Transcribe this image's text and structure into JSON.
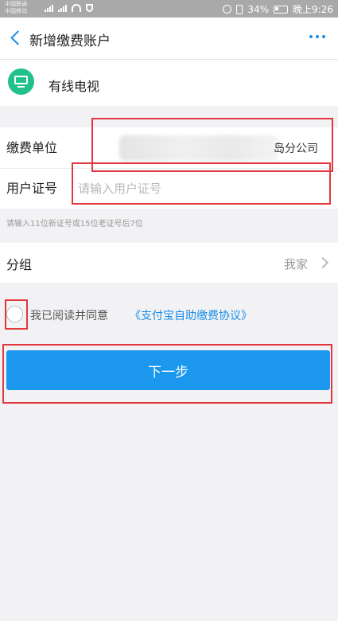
{
  "status_bar": {
    "carrier_1": "中国联通",
    "carrier_2": "中国移动",
    "battery": "34%",
    "time": "晚上9:26"
  },
  "nav": {
    "title": "新增缴费账户",
    "back_icon": "chevron-left-icon",
    "more_icon": "more-dots-icon"
  },
  "service": {
    "icon": "tv-icon",
    "icon_color": "#22c08a",
    "name": "有线电视"
  },
  "form": {
    "unit_label": "缴费单位",
    "unit_value_visible": "岛分公司",
    "user_id_label": "用户证号",
    "user_id_placeholder": "请输入用户证号",
    "user_id_value": ""
  },
  "hint": "请输入11位新证号或15位老证号后7位",
  "group": {
    "label": "分组",
    "value": "我家"
  },
  "agreement": {
    "checked": false,
    "text": "我已阅读并同意",
    "link": "《支付宝自助缴费协议》"
  },
  "next_button": {
    "label": "下一步",
    "color": "#1c97ee"
  },
  "colors": {
    "accent": "#1a8ee8",
    "annotation": "#e0383e"
  }
}
